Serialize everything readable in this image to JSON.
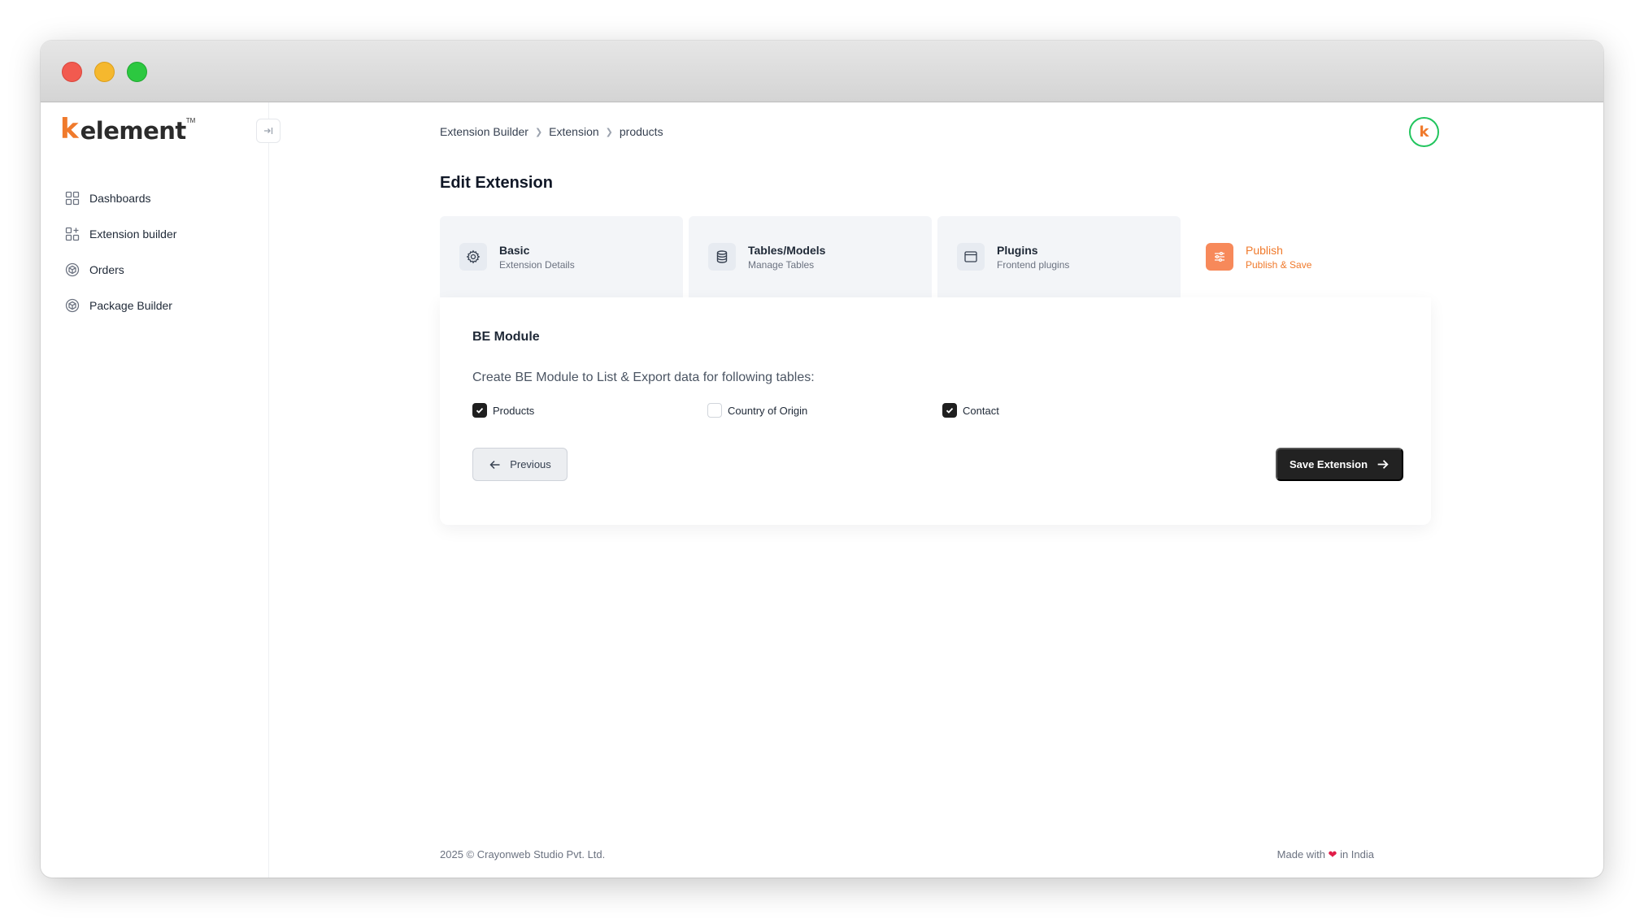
{
  "brand": {
    "logo_mark": "k",
    "logo_text": "element",
    "logo_tm": "TM",
    "avatar_mark": "k"
  },
  "sidebar": {
    "collapse_icon": "collapse-icon",
    "items": [
      {
        "label": "Dashboards",
        "icon": "grid-icon"
      },
      {
        "label": "Extension builder",
        "icon": "grid-plus-icon"
      },
      {
        "label": "Orders",
        "icon": "cube-icon"
      },
      {
        "label": "Package Builder",
        "icon": "cube-icon"
      }
    ]
  },
  "breadcrumb": [
    "Extension Builder",
    "Extension",
    "products"
  ],
  "page_title": "Edit Extension",
  "steps": [
    {
      "title": "Basic",
      "subtitle": "Extension Details",
      "icon": "gear-icon",
      "active": false
    },
    {
      "title": "Tables/Models",
      "subtitle": "Manage Tables",
      "icon": "database-icon",
      "active": false
    },
    {
      "title": "Plugins",
      "subtitle": "Frontend plugins",
      "icon": "window-icon",
      "active": false
    },
    {
      "title": "Publish",
      "subtitle": "Publish & Save",
      "icon": "sliders-icon",
      "active": true
    }
  ],
  "be_module": {
    "title": "BE Module",
    "description": "Create BE Module to List & Export data for following tables:",
    "tables": [
      {
        "label": "Products",
        "checked": true
      },
      {
        "label": "Country of Origin",
        "checked": false
      },
      {
        "label": "Contact",
        "checked": true
      }
    ]
  },
  "buttons": {
    "previous": "Previous",
    "save": "Save Extension"
  },
  "footer": {
    "copyright": "2025 ©  Crayonweb Studio Pvt. Ltd.",
    "made_with_prefix": "Made with",
    "made_with_suffix": "in India"
  },
  "colors": {
    "accent": "#f07a2c",
    "primary_button": "#222222",
    "avatar_ring": "#22c55e"
  }
}
